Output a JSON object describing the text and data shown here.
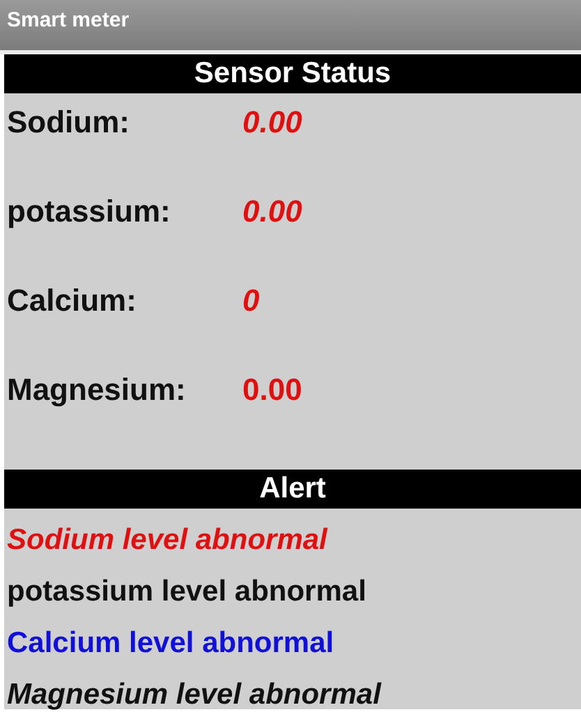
{
  "window": {
    "title": "Smart meter"
  },
  "sensor_status": {
    "title": "Sensor Status",
    "readings": [
      {
        "label": "Sodium:",
        "value": "0.00",
        "italic": true
      },
      {
        "label": "potassium:",
        "value": "0.00",
        "italic": true
      },
      {
        "label": "Calcium:",
        "value": "0",
        "italic": true
      },
      {
        "label": "Magnesium:",
        "value": "0.00",
        "italic": false
      }
    ]
  },
  "alert": {
    "title": "Alert",
    "messages": [
      {
        "text": "Sodium level abnormal",
        "color": "#e01010",
        "italic": true
      },
      {
        "text": "potassium level abnormal",
        "color": "#111111",
        "italic": false
      },
      {
        "text": "Calcium level abnormal",
        "color": "#1010d8",
        "italic": false
      },
      {
        "text": "Magnesium level abnormal",
        "color": "#111111",
        "italic": true
      }
    ]
  }
}
